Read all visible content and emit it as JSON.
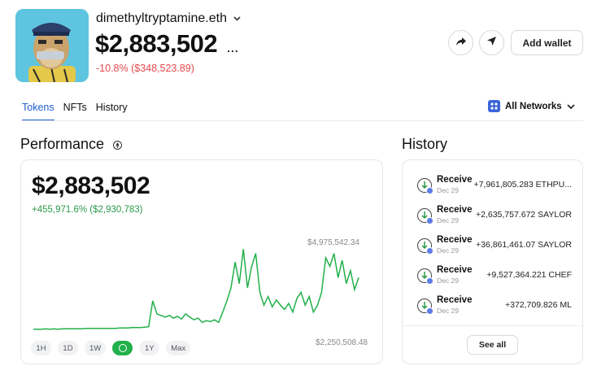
{
  "profile": {
    "ens_name": "dimethyltryptamine.eth",
    "balance": "$2,883,502",
    "more_label": "...",
    "change": "-10.8% ($348,523.89)"
  },
  "header_actions": {
    "add_wallet_label": "Add wallet"
  },
  "tabs": [
    {
      "label": "Tokens",
      "active": true
    },
    {
      "label": "NFTs",
      "active": false
    },
    {
      "label": "History",
      "active": false
    }
  ],
  "network_selector": {
    "label": "All Networks"
  },
  "performance": {
    "title": "Performance",
    "value": "$2,883,502",
    "change": "+455,971.6% ($2,930,783)",
    "chart_max_label": "$4,975,542.34",
    "chart_min_label": "$2,250,508.48",
    "ranges": [
      "1H",
      "1D",
      "1W",
      "",
      "1Y",
      "Max"
    ],
    "active_range_index": 3
  },
  "chart_data": {
    "type": "line",
    "title": "",
    "xlabel": "",
    "ylabel": "",
    "color": "#22b04a",
    "values": [
      0.02,
      0.02,
      0.02,
      0.025,
      0.02,
      0.025,
      0.02,
      0.025,
      0.025,
      0.025,
      0.025,
      0.025,
      0.025,
      0.03,
      0.03,
      0.03,
      0.03,
      0.03,
      0.03,
      0.03,
      0.03,
      0.035,
      0.035,
      0.035,
      0.04,
      0.04,
      0.04,
      0.045,
      0.05,
      0.35,
      0.2,
      0.18,
      0.16,
      0.18,
      0.15,
      0.17,
      0.14,
      0.2,
      0.16,
      0.13,
      0.15,
      0.1,
      0.12,
      0.11,
      0.13,
      0.1,
      0.22,
      0.35,
      0.5,
      0.8,
      0.55,
      0.95,
      0.5,
      0.75,
      0.9,
      0.45,
      0.3,
      0.4,
      0.28,
      0.36,
      0.3,
      0.25,
      0.32,
      0.22,
      0.38,
      0.45,
      0.3,
      0.4,
      0.22,
      0.3,
      0.45,
      0.85,
      0.75,
      0.9,
      0.62,
      0.82,
      0.55,
      0.7,
      0.48,
      0.62
    ]
  },
  "history": {
    "title": "History",
    "items": [
      {
        "type": "Receive",
        "date": "Dec 29",
        "amount": "+7,961,805.283 ETHPU..."
      },
      {
        "type": "Receive",
        "date": "Dec 29",
        "amount": "+2,635,757.672 SAYLOR"
      },
      {
        "type": "Receive",
        "date": "Dec 29",
        "amount": "+36,861,461.07 SAYLOR"
      },
      {
        "type": "Receive",
        "date": "Dec 29",
        "amount": "+9,527,364.221 CHEF"
      },
      {
        "type": "Receive",
        "date": "Dec 29",
        "amount": "+372,709.826 ML"
      }
    ],
    "see_all_label": "See all"
  },
  "colors": {
    "accent_blue": "#1f5fd1",
    "negative": "#e5484d",
    "positive": "#2b9a4a",
    "chart_line": "#22b04a"
  }
}
